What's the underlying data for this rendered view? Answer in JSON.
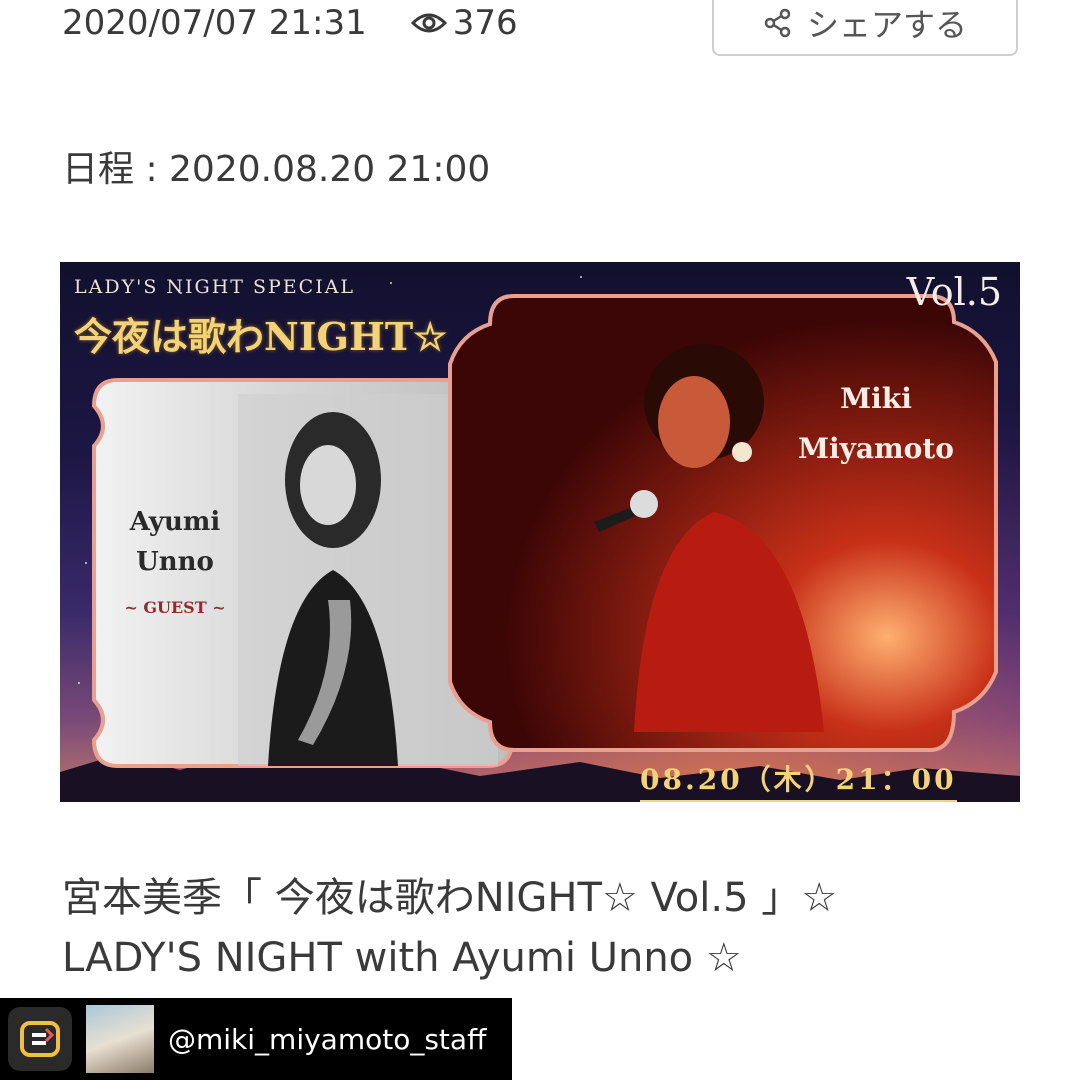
{
  "meta": {
    "datetime": "2020/07/07 21:31",
    "views": "376",
    "share_label": "シェアする"
  },
  "schedule": "日程 : 2020.08.20 21:00",
  "banner": {
    "subtitle": "LADY'S NIGHT SPECIAL",
    "title": "今夜は歌わNIGHT☆",
    "volume": "Vol.5",
    "guest_first": "Ayumi",
    "guest_last": "Unno",
    "guest_tag": "~ GUEST ~",
    "host_first": "Miki",
    "host_last": "Miyamoto",
    "date": "08.20（木）21：00"
  },
  "post": {
    "title_line1": "宮本美季「 今夜は歌わNIGHT☆ Vol.5 」☆",
    "title_line2": "LADY'S NIGHT with Ayumi Unno ☆"
  },
  "repost": {
    "username": "@miki_miyamoto_staff"
  },
  "icons": [
    "eye-icon",
    "share-icon",
    "repost-app-icon"
  ],
  "colors": {
    "gold": "#f4d27a",
    "text": "#3a3a3a",
    "frame": "#e8a090"
  }
}
